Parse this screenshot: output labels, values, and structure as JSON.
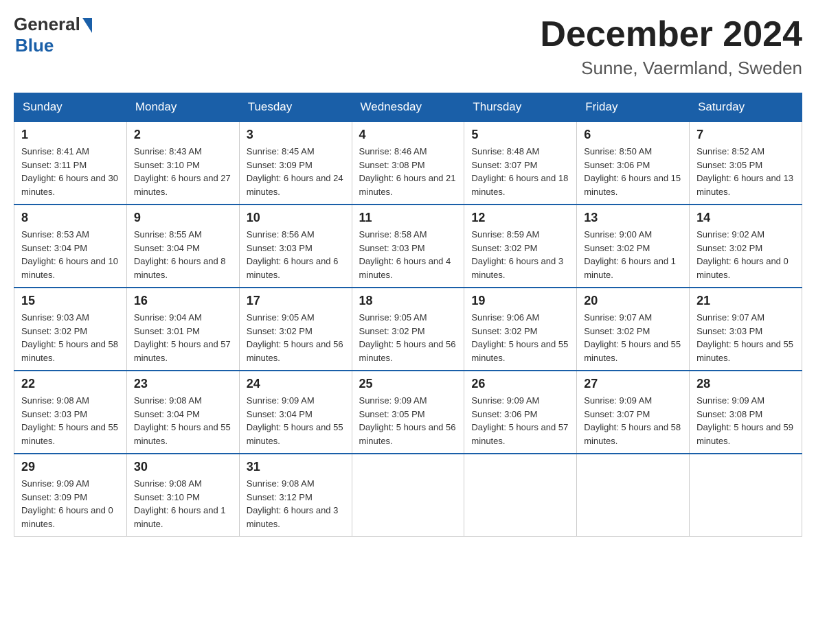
{
  "logo": {
    "general": "General",
    "blue": "Blue"
  },
  "title": "December 2024",
  "location": "Sunne, Vaermland, Sweden",
  "weekdays": [
    "Sunday",
    "Monday",
    "Tuesday",
    "Wednesday",
    "Thursday",
    "Friday",
    "Saturday"
  ],
  "weeks": [
    [
      {
        "day": "1",
        "sunrise": "8:41 AM",
        "sunset": "3:11 PM",
        "daylight": "6 hours and 30 minutes."
      },
      {
        "day": "2",
        "sunrise": "8:43 AM",
        "sunset": "3:10 PM",
        "daylight": "6 hours and 27 minutes."
      },
      {
        "day": "3",
        "sunrise": "8:45 AM",
        "sunset": "3:09 PM",
        "daylight": "6 hours and 24 minutes."
      },
      {
        "day": "4",
        "sunrise": "8:46 AM",
        "sunset": "3:08 PM",
        "daylight": "6 hours and 21 minutes."
      },
      {
        "day": "5",
        "sunrise": "8:48 AM",
        "sunset": "3:07 PM",
        "daylight": "6 hours and 18 minutes."
      },
      {
        "day": "6",
        "sunrise": "8:50 AM",
        "sunset": "3:06 PM",
        "daylight": "6 hours and 15 minutes."
      },
      {
        "day": "7",
        "sunrise": "8:52 AM",
        "sunset": "3:05 PM",
        "daylight": "6 hours and 13 minutes."
      }
    ],
    [
      {
        "day": "8",
        "sunrise": "8:53 AM",
        "sunset": "3:04 PM",
        "daylight": "6 hours and 10 minutes."
      },
      {
        "day": "9",
        "sunrise": "8:55 AM",
        "sunset": "3:04 PM",
        "daylight": "6 hours and 8 minutes."
      },
      {
        "day": "10",
        "sunrise": "8:56 AM",
        "sunset": "3:03 PM",
        "daylight": "6 hours and 6 minutes."
      },
      {
        "day": "11",
        "sunrise": "8:58 AM",
        "sunset": "3:03 PM",
        "daylight": "6 hours and 4 minutes."
      },
      {
        "day": "12",
        "sunrise": "8:59 AM",
        "sunset": "3:02 PM",
        "daylight": "6 hours and 3 minutes."
      },
      {
        "day": "13",
        "sunrise": "9:00 AM",
        "sunset": "3:02 PM",
        "daylight": "6 hours and 1 minute."
      },
      {
        "day": "14",
        "sunrise": "9:02 AM",
        "sunset": "3:02 PM",
        "daylight": "6 hours and 0 minutes."
      }
    ],
    [
      {
        "day": "15",
        "sunrise": "9:03 AM",
        "sunset": "3:02 PM",
        "daylight": "5 hours and 58 minutes."
      },
      {
        "day": "16",
        "sunrise": "9:04 AM",
        "sunset": "3:01 PM",
        "daylight": "5 hours and 57 minutes."
      },
      {
        "day": "17",
        "sunrise": "9:05 AM",
        "sunset": "3:02 PM",
        "daylight": "5 hours and 56 minutes."
      },
      {
        "day": "18",
        "sunrise": "9:05 AM",
        "sunset": "3:02 PM",
        "daylight": "5 hours and 56 minutes."
      },
      {
        "day": "19",
        "sunrise": "9:06 AM",
        "sunset": "3:02 PM",
        "daylight": "5 hours and 55 minutes."
      },
      {
        "day": "20",
        "sunrise": "9:07 AM",
        "sunset": "3:02 PM",
        "daylight": "5 hours and 55 minutes."
      },
      {
        "day": "21",
        "sunrise": "9:07 AM",
        "sunset": "3:03 PM",
        "daylight": "5 hours and 55 minutes."
      }
    ],
    [
      {
        "day": "22",
        "sunrise": "9:08 AM",
        "sunset": "3:03 PM",
        "daylight": "5 hours and 55 minutes."
      },
      {
        "day": "23",
        "sunrise": "9:08 AM",
        "sunset": "3:04 PM",
        "daylight": "5 hours and 55 minutes."
      },
      {
        "day": "24",
        "sunrise": "9:09 AM",
        "sunset": "3:04 PM",
        "daylight": "5 hours and 55 minutes."
      },
      {
        "day": "25",
        "sunrise": "9:09 AM",
        "sunset": "3:05 PM",
        "daylight": "5 hours and 56 minutes."
      },
      {
        "day": "26",
        "sunrise": "9:09 AM",
        "sunset": "3:06 PM",
        "daylight": "5 hours and 57 minutes."
      },
      {
        "day": "27",
        "sunrise": "9:09 AM",
        "sunset": "3:07 PM",
        "daylight": "5 hours and 58 minutes."
      },
      {
        "day": "28",
        "sunrise": "9:09 AM",
        "sunset": "3:08 PM",
        "daylight": "5 hours and 59 minutes."
      }
    ],
    [
      {
        "day": "29",
        "sunrise": "9:09 AM",
        "sunset": "3:09 PM",
        "daylight": "6 hours and 0 minutes."
      },
      {
        "day": "30",
        "sunrise": "9:08 AM",
        "sunset": "3:10 PM",
        "daylight": "6 hours and 1 minute."
      },
      {
        "day": "31",
        "sunrise": "9:08 AM",
        "sunset": "3:12 PM",
        "daylight": "6 hours and 3 minutes."
      },
      null,
      null,
      null,
      null
    ]
  ]
}
